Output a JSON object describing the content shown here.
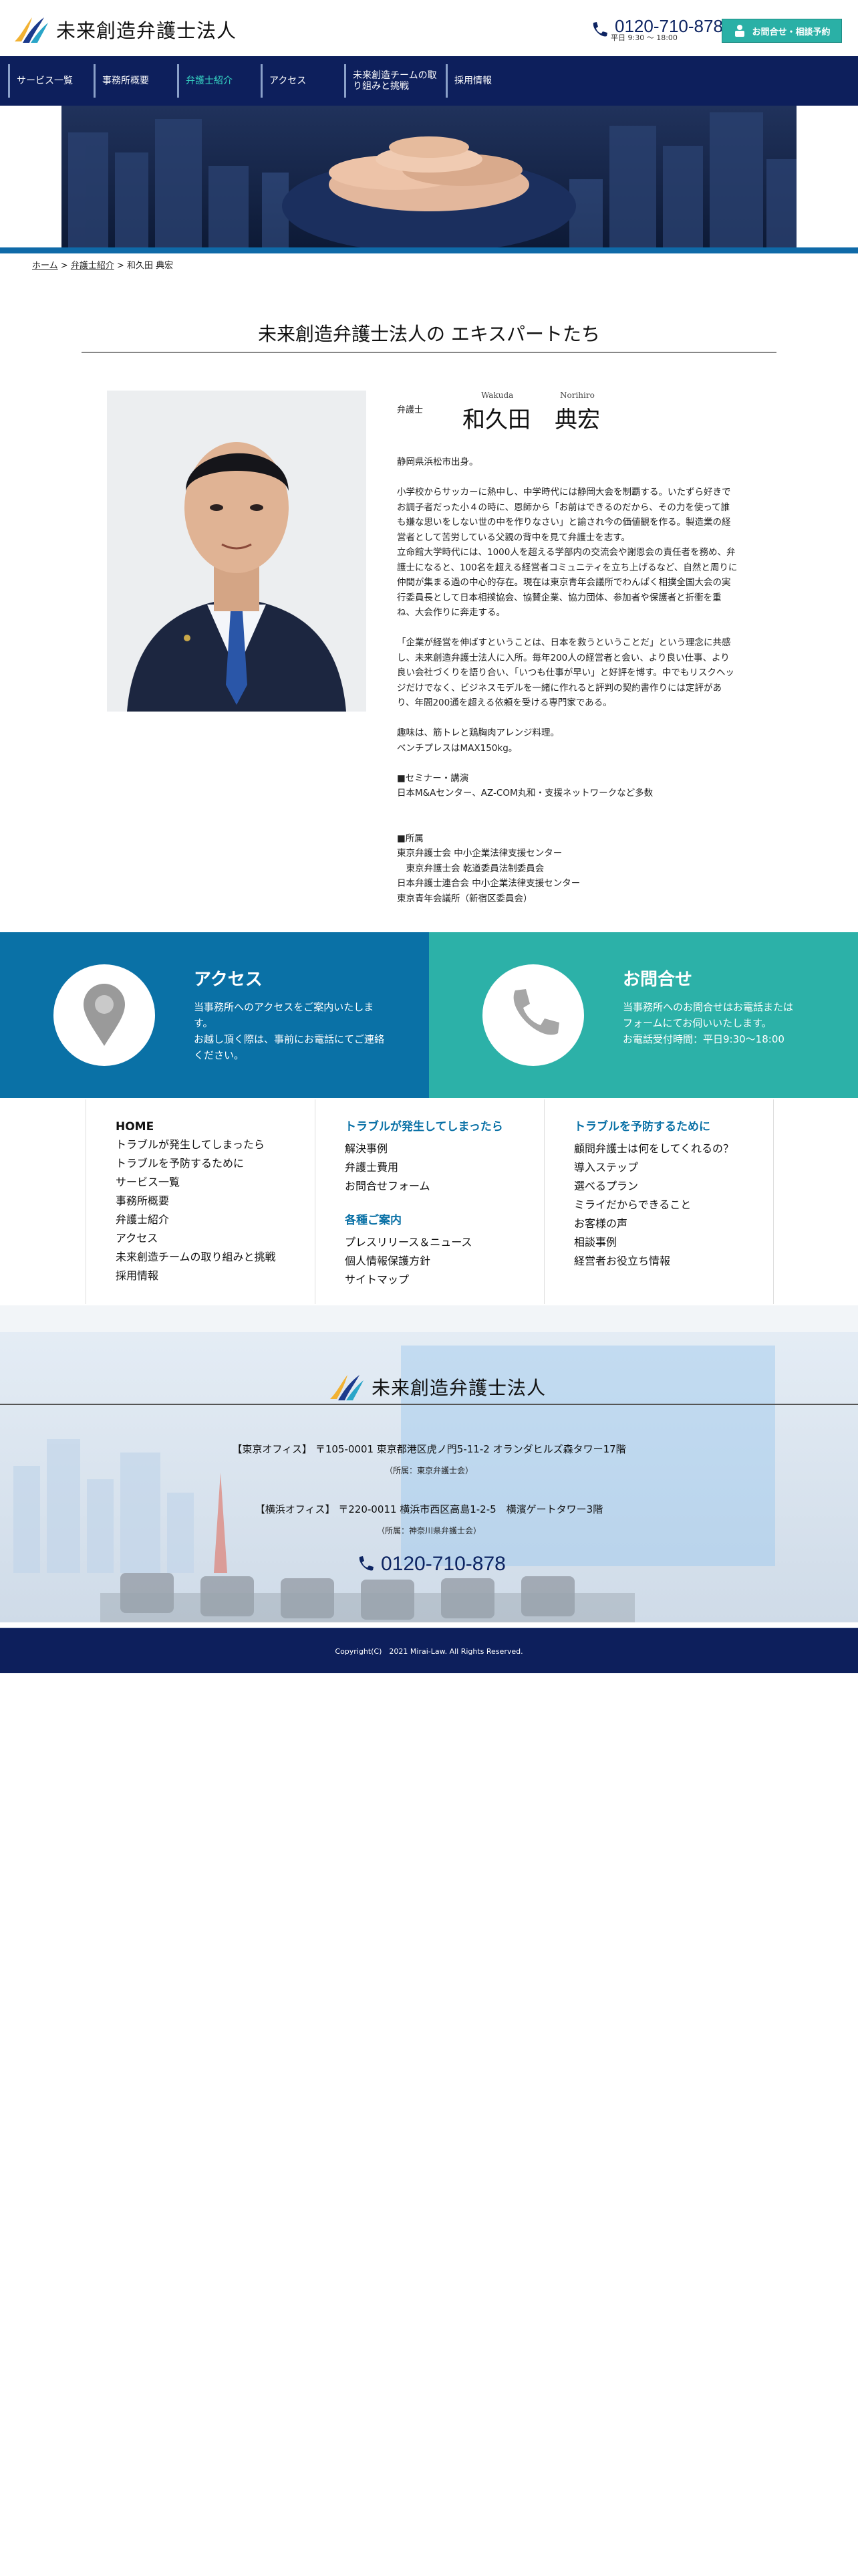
{
  "brand": {
    "name": "未来創造弁護士法人"
  },
  "header": {
    "phone": "0120-710-878",
    "hours": "平日 9:30 ～ 18:00",
    "contact_button": "お問合せ・相談予約"
  },
  "nav": [
    {
      "label": "サービス一覧"
    },
    {
      "label": "事務所概要"
    },
    {
      "label": "弁護士紹介",
      "active": true
    },
    {
      "label": "アクセス"
    },
    {
      "label": "未来創造チームの取り組みと挑戦"
    },
    {
      "label": "採用情報"
    }
  ],
  "breadcrumb": {
    "home": "ホーム",
    "sep1": ">",
    "section": "弁護士紹介",
    "sep2": ">",
    "current": "和久田 典宏"
  },
  "section_title": "未来創造弁護士法人の エキスパートたち",
  "profile": {
    "role": "弁護士",
    "reading_family": "Wakuda",
    "reading_given": "Norihiro",
    "family_name": "和久田",
    "given_name": "典宏",
    "bio": "静岡県浜松市出身。\n\n小学校からサッカーに熱中し、中学時代には静岡大会を制覇する。いたずら好きで\nお調子者だった小４の時に、恩師から「お前はできるのだから、その力を使って誰\nも嫌な思いをしない世の中を作りなさい」と諭され今の価値観を作る。製造業の経\n営者として苦労している父親の背中を見て弁護士を志す。\n立命館大学時代には、1000人を超える学部内の交流会や謝恩会の責任者を務め、弁\n護士になると、100名を超える経営者コミュニティを立ち上げるなど、自然と周りに\n仲間が集まる過の中心的存在。現在は東京青年会議所でわんぱく相撲全国大会の実\n行委員長として日本相撲協会、協賛企業、協力団体、参加者や保護者と折衝を重\nね、大会作りに奔走する。\n\n「企業が経営を伸ばすということは、日本を救うということだ」という理念に共感\nし、未来創造弁護士法人に入所。毎年200人の経営者と会い、より良い仕事、より\n良い会社づくりを語り合い、「いつも仕事が早い」と好評を博す。中でもリスクヘッ\nジだけでなく、ビジネスモデルを一緒に作れると評判の契約書作りには定評があ\nり、年間200通を超える依頼を受ける専門家である。\n\n趣味は、筋トレと鶏胸肉アレンジ料理。\nベンチプレスはMAX150kg。\n\n■セミナー・講演\n日本M&Aセンター、AZ-COM丸和・支援ネットワークなど多数\n\n\n■所属\n東京弁護士会 中小企業法律支援センター\n　東京弁護士会 乾道委員法制委員会\n日本弁護士連合会 中小企業法律支援センター\n東京青年会議所（新宿区委員会）"
  },
  "cta": {
    "access": {
      "title": "アクセス",
      "text": "当事務所へのアクセスをご案内いたします。\nお越し頂く際は、事前にお電話にてご連絡ください。"
    },
    "contact": {
      "title": "お問合せ",
      "text": "当事務所へのお問合せはお電話または\nフォームにてお伺いいたします。\nお電話受付時間：平日9:30〜18:00"
    }
  },
  "sitemap": {
    "col1": {
      "home": "HOME",
      "links": [
        "トラブルが発生してしまったら",
        "トラブルを予防するために",
        "サービス一覧",
        "事務所概要",
        "弁護士紹介",
        "アクセス",
        "未来創造チームの取り組みと挑戦",
        "採用情報"
      ]
    },
    "col2": {
      "head1": "トラブルが発生してしまったら",
      "links1": [
        "解決事例",
        "弁護士費用",
        "お問合せフォーム"
      ],
      "head2": "各種ご案内",
      "links2": [
        "プレスリリース＆ニュース",
        "個人情報保護方針",
        "サイトマップ"
      ]
    },
    "col3": {
      "head": "トラブルを予防するために",
      "links": [
        "顧問弁護士は何をしてくれるの？",
        "導入ステップ",
        "選べるプラン",
        "ミライだからできること",
        "お客様の声",
        "相談事例",
        "経営者お役立ち情報"
      ]
    }
  },
  "footer": {
    "tokyo": "【東京オフィス】 〒105-0001 東京都港区虎ノ門5-11-2 オランダヒルズ森タワー17階",
    "tokyo_sub": "（所属：東京弁護士会）",
    "yokohama": "【横浜オフィス】 〒220-0011 横浜市西区高島1-2-5　横濱ゲートタワー3階",
    "yokohama_sub": "（所属：神奈川県弁護士会）",
    "phone": "0120-710-878",
    "copyright": "Copyright(C)　2021 Mirai-Law. All Rights Reserved."
  },
  "colors": {
    "navy": "#0d1f5c",
    "teal": "#2ab0a6",
    "blue": "#0a71a6"
  }
}
